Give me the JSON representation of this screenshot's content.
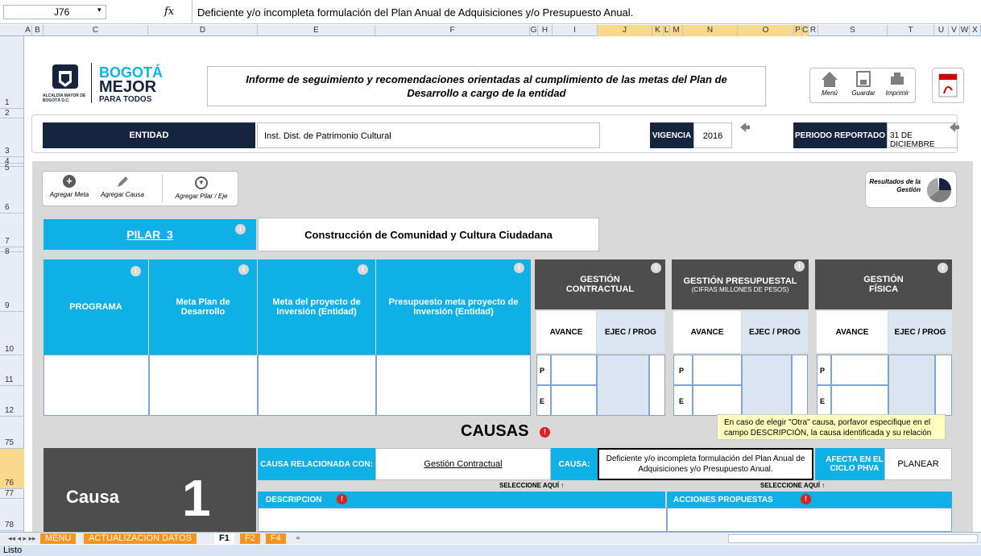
{
  "formula_bar": {
    "cell_ref": "J76",
    "fx": "fx",
    "formula": "Deficiente y/o incompleta formulación del Plan Anual de Adquisiciones y/o Presupuesto Anual."
  },
  "columns": [
    "A",
    "B",
    "C",
    "D",
    "E",
    "F",
    "G",
    "H",
    "I",
    "J",
    "K",
    "L",
    "M",
    "N",
    "O",
    "P",
    "C",
    "R",
    "S",
    "T",
    "U",
    "V",
    "W",
    "X"
  ],
  "rows": [
    "1",
    "2",
    "3",
    "4",
    "5",
    "6",
    "7",
    "8",
    "9",
    "10",
    "11",
    "12",
    "75",
    "76",
    "77",
    "78"
  ],
  "logo": {
    "alcaldia": "ALCALDÍA MAYOR DE BOGOTÁ D.C.",
    "bogota": "BOGOTÁ",
    "mejor": "MEJOR",
    "para_todos": "PARA TODOS"
  },
  "report_title": "Informe de seguimiento y recomendaciones orientadas al cumplimiento de las metas del Plan de Desarrollo a cargo de la entidad",
  "top_buttons": {
    "menu": "Menú",
    "guardar": "Guardar",
    "imprimir": "Imprimir",
    "pdf": "PDF"
  },
  "entidad": {
    "label": "ENTIDAD",
    "value": "Inst. Dist. de Patrimonio Cultural"
  },
  "vigencia": {
    "label": "VIGENCIA",
    "value": "2016"
  },
  "periodo": {
    "label": "PERIODO REPORTADO",
    "value": "31 DE DICIEMBRE"
  },
  "actions": {
    "agregar_meta": "Agregar Meta",
    "agregar_causa": "Agregar Causa",
    "agregar_pilar": "Agregar Pilar / Eje"
  },
  "resultados": "Resultados de la Gestión",
  "pilar": {
    "name": "PILAR_3",
    "desc": "Construcción de Comunidad y Cultura Ciudadana"
  },
  "table_headers": {
    "programa": "PROGRAMA",
    "meta_plan": "Meta Plan de Desarrollo",
    "meta_proyecto": "Meta del proyecto de Inversión (Entidad)",
    "presupuesto": "Presupuesto meta proyecto de Inversión (Entidad)",
    "gestion_contractual": "GESTIÓN CONTRACTUAL",
    "gestion_presupuestal": "GESTIÓN PRESUPUESTAL",
    "gestion_presupuestal_sub": "(CIFRAS MILLONES DE PESOS)",
    "gestion_fisica": "GESTIÓN FÍSICA",
    "avance": "AVANCE",
    "ejec_prog": "EJEC / PROG",
    "p": "P",
    "e": "E"
  },
  "causas": {
    "title": "CAUSAS",
    "tooltip": "En caso de elegir \"Otra\" causa, porfavor especifique en el campo DESCRIPCIÓN, la causa identificada y su relación con",
    "causa_label": "Causa",
    "causa_num": "1",
    "relacionada_label": "CAUSA RELACIONADA CON:",
    "relacionada_value": "Gestión Contractual",
    "causa_field_label": "CAUSA:",
    "causa_value": "Deficiente y/o incompleta formulación del Plan Anual de Adquisiciones y/o Presupuesto Anual.",
    "afecta_label": "AFECTA EN EL CICLO PHVA",
    "afecta_value": "PLANEAR",
    "seleccione": "SELECCIONE AQUÍ ↑",
    "descripcion": "DESCRIPCION",
    "acciones": "ACCIONES PROPUESTAS"
  },
  "tabs": [
    "MENU",
    "ACTUALIZACION DATOS",
    "F1",
    "F2",
    "F4"
  ],
  "status": "Listo"
}
